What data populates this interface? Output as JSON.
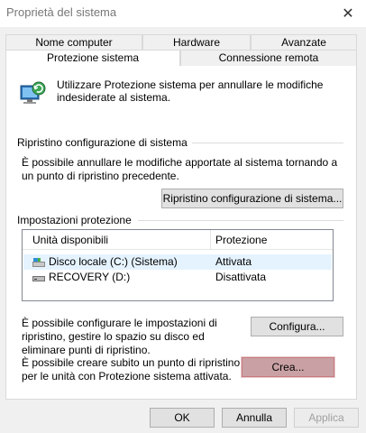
{
  "window": {
    "title": "Proprietà del sistema",
    "close_glyph": "✕"
  },
  "tabs_back": [
    "Nome computer",
    "Hardware",
    "Avanzate"
  ],
  "tabs_front": [
    "Protezione sistema",
    "Connessione remota"
  ],
  "intro": "Utilizzare Protezione sistema per annullare le modifiche indesiderate al sistema.",
  "restore": {
    "group_title": "Ripristino configurazione di sistema",
    "description": "È possibile annullare le modifiche apportate al sistema tornando a un punto di ripristino precedente.",
    "button": "Ripristino configurazione di sistema..."
  },
  "settings": {
    "group_title": "Impostazioni protezione",
    "columns": [
      "Unità disponibili",
      "Protezione"
    ],
    "rows": [
      {
        "name": "Disco locale (C:) (Sistema)",
        "status": "Attivata",
        "icon": "system-drive-icon"
      },
      {
        "name": "RECOVERY (D:)",
        "status": "Disattivata",
        "icon": "drive-icon"
      }
    ],
    "configure_text": "È possibile configurare le impostazioni di ripristino, gestire lo spazio su disco ed eliminare punti di ripristino.",
    "configure_button": "Configura...",
    "create_text": "È possibile creare subito un punto di ripristino per le unità con Protezione sistema attivata.",
    "create_button": "Crea..."
  },
  "footer": {
    "ok": "OK",
    "cancel": "Annulla",
    "apply": "Applica"
  },
  "colors": {
    "selection": "#e5f3ff",
    "highlight": "#c9a1a4",
    "tab_border": "#d9d9d9"
  }
}
